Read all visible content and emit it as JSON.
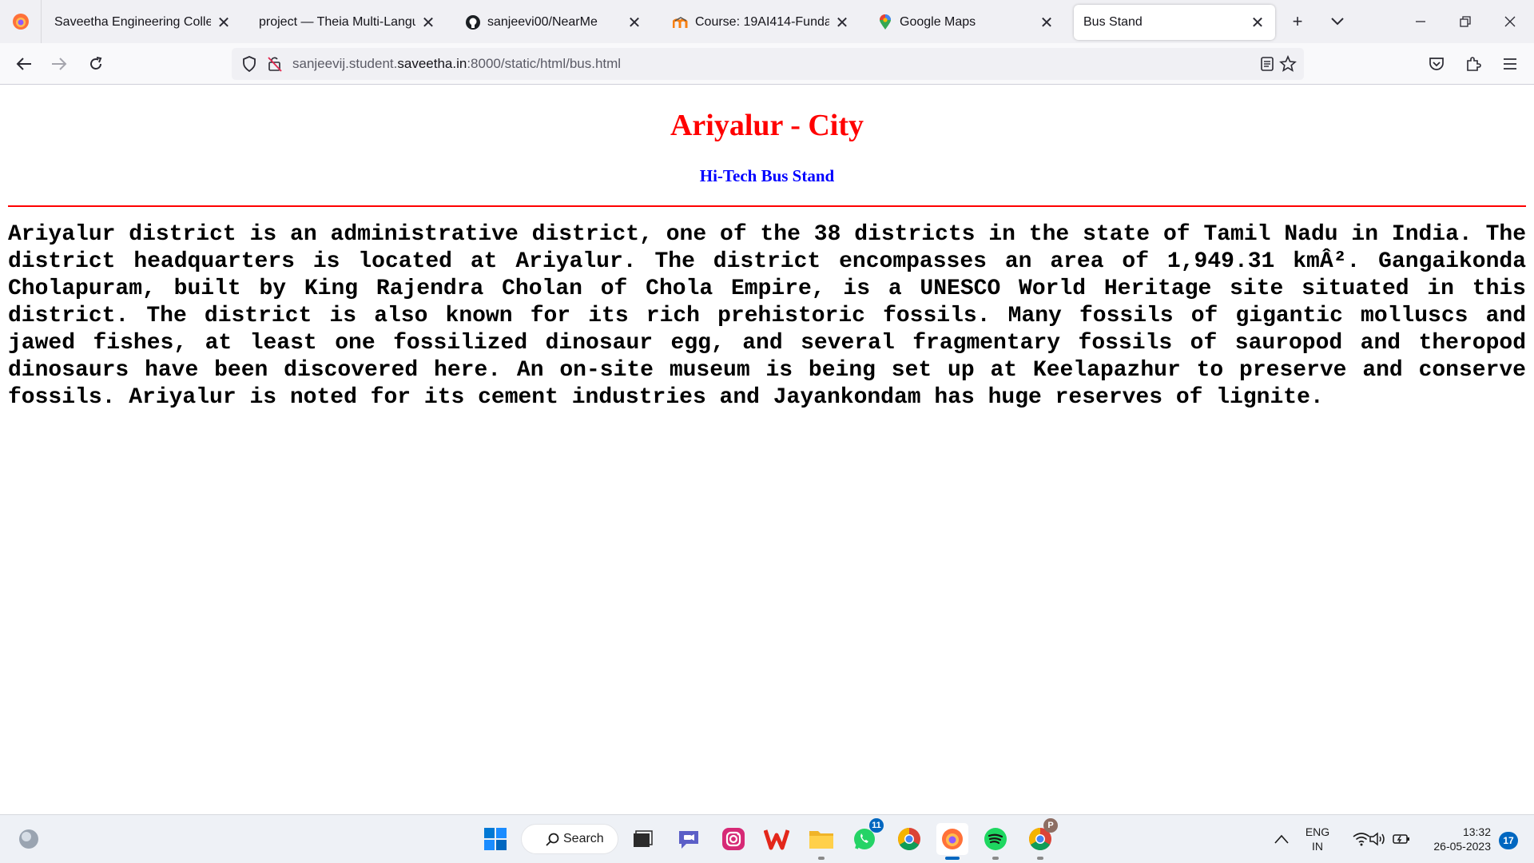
{
  "browser": {
    "tabs": [
      {
        "title": "Saveetha Engineering College",
        "icon": "firefox-icon"
      },
      {
        "title": "project — Theia Multi-Language",
        "icon": "none"
      },
      {
        "title": "sanjeevi00/NearMe",
        "icon": "github-icon"
      },
      {
        "title": "Course: 19AI414-Fundament",
        "icon": "moodle-icon"
      },
      {
        "title": "Google Maps",
        "icon": "maps-pin-icon"
      },
      {
        "title": "Bus Stand",
        "icon": "none",
        "active": true
      }
    ],
    "url": {
      "prefix": "sanjeevij.student.",
      "host": "saveetha.in",
      "suffix": ":8000/static/html/bus.html"
    }
  },
  "page": {
    "title": "Ariyalur - City",
    "subtitle": "Hi-Tech Bus Stand",
    "body": "Ariyalur district is an administrative district, one of the 38 districts in the state of Tamil Nadu in India. The district headquarters is located at Ariyalur. The district encompasses an area of 1,949.31 kmÂ². Gangaikonda Cholapuram, built by King Rajendra Cholan of Chola Empire, is a UNESCO World Heritage site situated in this district. The district is also known for its rich prehistoric fossils. Many fossils of gigantic molluscs and jawed fishes, at least one fossilized dinosaur egg, and several fragmentary fossils of sauropod and theropod dinosaurs have been discovered here. An on-site museum is being set up at Keelapazhur to preserve and conserve fossils. Ariyalur is noted for its cement industries and Jayankondam has huge reserves of lignite."
  },
  "taskbar": {
    "search_label": "Search",
    "whatsapp_badge": "11",
    "chrome_profile_badge": "P",
    "language": "ENG",
    "region": "IN",
    "time": "13:32",
    "date": "26-05-2023",
    "notification_count": "17"
  },
  "colors": {
    "title": "#ff0000",
    "subtitle": "#0000ff",
    "divider": "#ff0000",
    "accent": "#0067c0"
  }
}
